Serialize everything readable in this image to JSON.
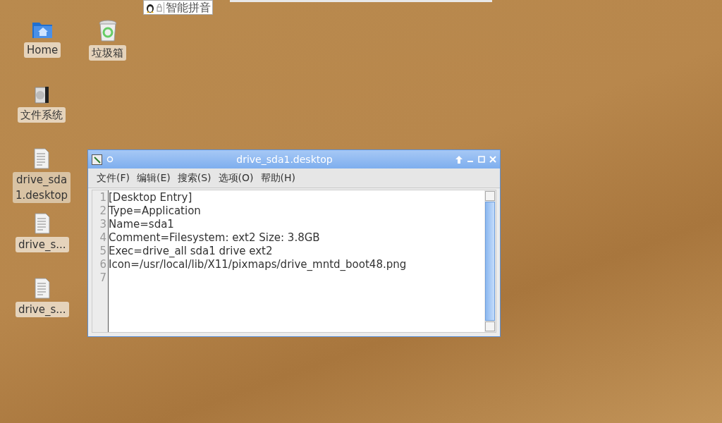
{
  "input_method": {
    "label": "智能拼音"
  },
  "desktop_icons": [
    {
      "kind": "home",
      "label": "Home",
      "selected": false
    },
    {
      "kind": "trash",
      "label": "垃圾箱",
      "selected": false
    },
    {
      "kind": "drive",
      "label": "文件系统",
      "selected": false
    },
    {
      "kind": "file",
      "label": "drive_sda\n1.desktop",
      "selected": true
    },
    {
      "kind": "file",
      "label": "drive_s...",
      "selected": false
    },
    {
      "kind": "file",
      "label": "drive_s...",
      "selected": false
    }
  ],
  "window": {
    "title": "drive_sda1.desktop",
    "menu": [
      "文件(F)",
      "编辑(E)",
      "搜索(S)",
      "选项(O)",
      "帮助(H)"
    ],
    "lines": [
      {
        "number": "1",
        "text": "[Desktop Entry]"
      },
      {
        "number": "2",
        "text": "Type=Application"
      },
      {
        "number": "3",
        "text": "Name=sda1"
      },
      {
        "number": "4",
        "text": "Comment=Filesystem: ext2 Size: 3.8GB"
      },
      {
        "number": "5",
        "text": "Exec=drive_all sda1 drive ext2"
      },
      {
        "number": "6",
        "text": "Icon=/usr/local/lib/X11/pixmaps/drive_mntd_boot48.png"
      },
      {
        "number": "7"
      }
    ]
  }
}
